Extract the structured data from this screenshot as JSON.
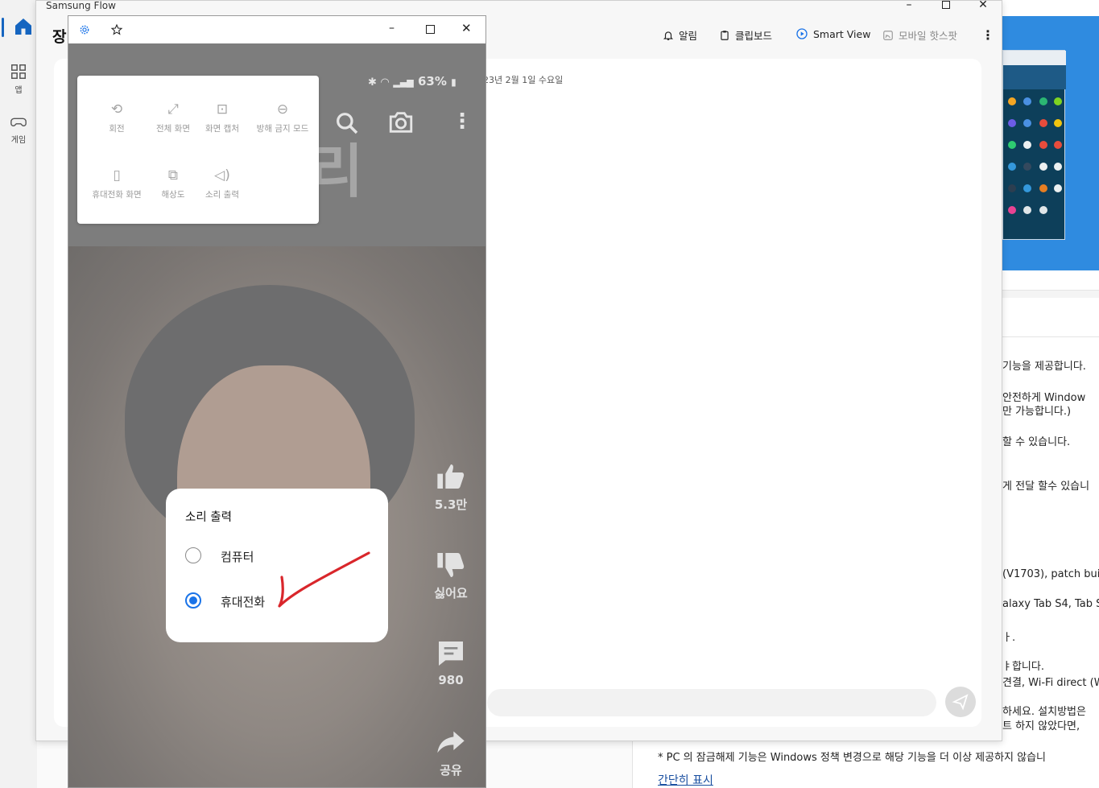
{
  "flow_window": {
    "title": "Samsung Flow",
    "heading_partial": "장",
    "toolbar": {
      "alerts": "알림",
      "clipboard": "클립보드",
      "smart_view": "Smart View",
      "hotspot": "모바일 핫스팟"
    },
    "date_partial": "23년 2월 1일 수요일"
  },
  "left_rail": {
    "apps_label": "앱",
    "games_label": "게임"
  },
  "mirror_window": {
    "status": {
      "battery": "63%"
    },
    "settings_menu": {
      "rotate": "회전",
      "fullscreen": "전체 화면",
      "screenshot": "화면 캡처",
      "dnd": "방해 금지 모드",
      "phone_screen": "휴대전화 화면",
      "resolution": "해상도",
      "sound_output": "소리 출력"
    },
    "video_side": {
      "likes": "5.3만",
      "dislike": "싫어요",
      "comments": "980",
      "share": "공유"
    },
    "title_partial": "리",
    "sound_dialog": {
      "title": "소리 출력",
      "options": [
        "컴퓨터",
        "휴대전화"
      ],
      "selected": "휴대전화"
    }
  },
  "background_page": {
    "lines": [
      "기능을 제공합니다.",
      "안전하게 Window",
      "만 가능합니다.)",
      "할 수 있습니다.",
      "게 전달 할수 있습니",
      "(V1703), patch buil",
      "alaxy Tab S4, Tab S",
      "ㅏ.",
      "ㅑ합니다.",
      "견결, Wi-Fi direct (W",
      "하세요. 설치방법은",
      "트 하지 않았다면,"
    ],
    "footer_note": "* PC 의 잠금해제 기능은 Windows 정책 변경으로 해당 기능을 더 이상 제공하지 않습니",
    "show_less_link": "간단히 표시"
  },
  "colors": {
    "accent": "#1a73e8",
    "rail_accent": "#1565c0",
    "annotation": "#d9262b"
  }
}
